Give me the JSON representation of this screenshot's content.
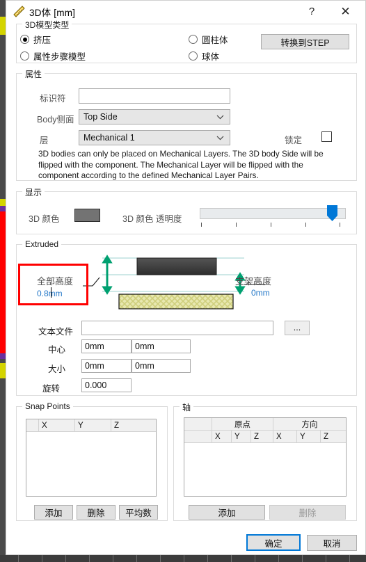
{
  "window": {
    "title": "3D体 [mm]",
    "icon": "ruler-triangle-icon",
    "help_label": "?",
    "close_label": "✕"
  },
  "model_type": {
    "legend": "3D模型类型",
    "options": [
      {
        "label": "挤压",
        "selected": true
      },
      {
        "label": "属性步骤模型",
        "selected": false
      },
      {
        "label": "圆柱体",
        "selected": false
      },
      {
        "label": "球体",
        "selected": false
      }
    ],
    "convert_button": "转换到STEP"
  },
  "properties": {
    "legend": "属性",
    "identifier_label": "标识符",
    "identifier_value": "",
    "body_side_label": "Body侧面",
    "body_side_value": "Top Side",
    "layer_label": "层",
    "layer_value": "Mechanical 1",
    "lock_label": "锁定",
    "lock_checked": false,
    "note": "3D bodies can only be placed on Mechanical Layers. The 3D body Side will be flipped with the component. The Mechanical Layer will be flipped with the component according to the defined Mechanical Layer Pairs."
  },
  "display": {
    "legend": "显示",
    "color_label": "3D 颜色",
    "color_value": "#737373",
    "transparency_label": "3D 颜色 透明度",
    "transparency_percent": 100,
    "tick_count": 5
  },
  "extruded": {
    "legend": "Extruded",
    "overall_height_label": "全部高度",
    "overall_height_value": "0.8mm",
    "standoff_height_label": "支架高度",
    "standoff_height_value": "0mm",
    "highlight_color": "#ff0000",
    "text_file_label": "文本文件",
    "text_file_value": "",
    "browse_button": "...",
    "center_label": "中心",
    "center_x": "0mm",
    "center_y": "0mm",
    "size_label": "大小",
    "size_x": "0mm",
    "size_y": "0mm",
    "rotation_label": "旋转",
    "rotation_value": "0.000"
  },
  "snap_points": {
    "legend": "Snap Points",
    "columns": [
      "",
      "X",
      "Y",
      "Z"
    ],
    "rows": [],
    "add_button": "添加",
    "delete_button": "删除",
    "average_button": "平均数"
  },
  "axis": {
    "legend": "轴",
    "group_headers": [
      "",
      "原点",
      "方向"
    ],
    "sub_columns": [
      "",
      "X",
      "Y",
      "Z",
      "X",
      "Y",
      "Z"
    ],
    "rows": [],
    "add_button": "添加",
    "delete_button": "删除",
    "delete_disabled": true
  },
  "footer": {
    "ok_button": "确定",
    "cancel_button": "取消",
    "focus_color": "#0078d7"
  }
}
